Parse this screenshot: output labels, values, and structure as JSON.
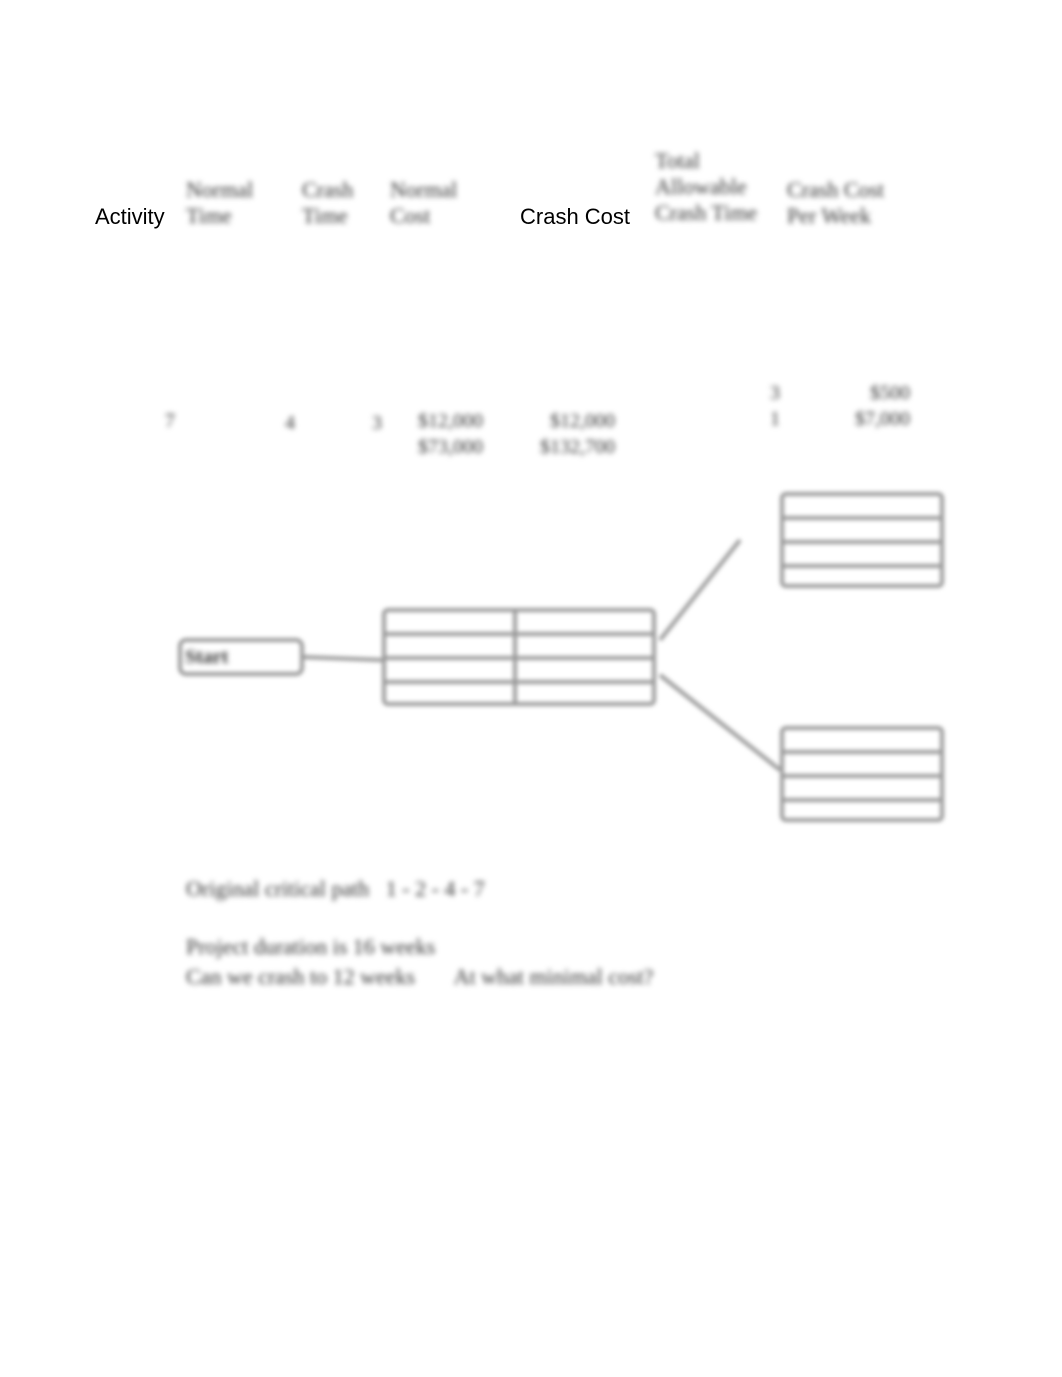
{
  "header": {
    "activity": "Activity",
    "normal_time": [
      "Normal",
      "Time"
    ],
    "crash_time": [
      "Crash",
      "Time"
    ],
    "normal_cost": [
      "Normal",
      "Cost"
    ],
    "crash_cost": "Crash Cost",
    "total_allowable": [
      "Total",
      "Allowable",
      "Crash Time"
    ],
    "crash_cost_per_week": [
      "Crash Cost",
      "Per Week"
    ]
  },
  "rows": {
    "activity": "7",
    "normal_time": "4",
    "crash_time": "3",
    "normal_cost": [
      "$12,000",
      "$73,000"
    ],
    "crash_cost": [
      "$12,000",
      "$132,700"
    ],
    "allowable": [
      "3",
      "1"
    ],
    "per_week": [
      "$500",
      "$7,000"
    ]
  },
  "diagram": {
    "start_label": "Start"
  },
  "notes": {
    "critical_path_label": "Original critical path",
    "critical_path": "1 - 2 - 4 - 7",
    "duration": "Project duration is 16 weeks",
    "question": "Can we crash to 12 weeks",
    "question2": "At what minimal cost?"
  }
}
